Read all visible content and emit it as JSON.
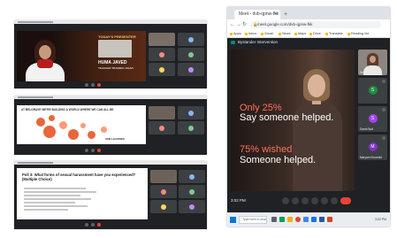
{
  "left_collage": {
    "shot1": {
      "banner": "TODAY'S PRESENTER",
      "presenter_name": "HUMA JAVED",
      "presenter_role": "TEACHER TRAINER / HEAD"
    },
    "shot2": {
      "banner": "AT BELGRAVE WE'RE BUILDING A WORLD WHERE WE CAN ALL BE",
      "footer": "ONE LEARNER"
    },
    "shot3": {
      "question": "Poll 3: What forms of sexual harassment have you experienced? (Multiple Choice)"
    }
  },
  "browser": {
    "tab_title": "Meet - dvb-qpnw-fkk",
    "url": "meet.google.com/dvb-qpnw-fkk",
    "bookmarks": [
      "Apps",
      "Inbox",
      "Gmail",
      "News",
      "Maps",
      "Drive",
      "Translate",
      "Reading list"
    ],
    "meet_title": "Bystander Intervention",
    "stage_lines": [
      "Only 25%",
      "Say someone helped.",
      "75% wished",
      "Someone helped."
    ],
    "participants": [
      {
        "name": "Huma Javed",
        "letter": "",
        "color": "#5f6368"
      },
      {
        "name": "S",
        "letter": "S",
        "color": "#1e8e3e"
      },
      {
        "name": "Sarah Butt",
        "letter": "S",
        "color": "#a142f4"
      },
      {
        "name": "Maryam Khurshid",
        "letter": "M",
        "color": "#8430ce"
      }
    ],
    "clock": "3:02 PM",
    "taskbar_search": "Type here to search",
    "tray_time": "3:02 PM"
  }
}
